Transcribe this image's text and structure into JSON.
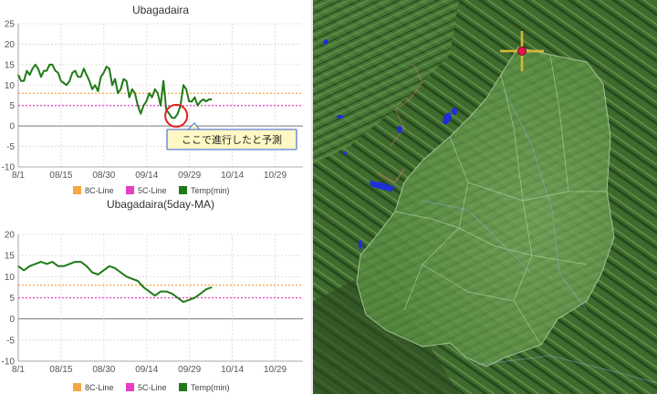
{
  "chart_data": [
    {
      "type": "line",
      "title": "Ubagadaira",
      "x_ticks": [
        "8/1",
        "08/15",
        "08/30",
        "09/14",
        "09/29",
        "10/14",
        "10/29"
      ],
      "y_ticks": [
        25,
        20,
        15,
        10,
        5,
        0,
        -5,
        -10
      ],
      "ylim": [
        -10,
        25
      ],
      "grid": true,
      "legend": [
        "8C-Line",
        "5C-Line",
        "Temp(min)"
      ],
      "legend_position": "bottom",
      "annotation": "ここで進行したと予測",
      "series": [
        {
          "name": "8C-Line",
          "color": "#f5a742",
          "style": "dotted",
          "x": [
            0,
            100
          ],
          "values": [
            8,
            8
          ]
        },
        {
          "name": "5C-Line",
          "color": "#e83ec4",
          "style": "dotted",
          "x": [
            0,
            100
          ],
          "values": [
            5,
            5
          ]
        },
        {
          "name": "Temp(min)",
          "color": "#1f7a17",
          "style": "solid",
          "x": [
            0,
            1,
            2,
            3,
            4,
            5,
            6,
            7,
            8,
            9,
            10,
            11,
            12,
            13,
            14,
            15,
            16,
            17,
            18,
            19,
            20,
            21,
            22,
            23,
            24,
            25,
            26,
            27,
            28,
            29,
            30,
            31,
            32,
            33,
            34,
            35,
            36,
            37,
            38,
            39,
            40,
            41,
            42,
            43,
            44,
            45,
            46,
            47,
            48,
            49,
            50,
            51,
            52,
            53,
            54,
            55,
            56,
            57,
            58,
            59,
            60,
            61,
            62,
            63,
            64,
            65,
            66,
            67,
            68
          ],
          "values": [
            12.5,
            11,
            11,
            13.5,
            12.5,
            14,
            15,
            14,
            12,
            13.5,
            13.5,
            15,
            15,
            13.5,
            13,
            11,
            10.5,
            10,
            11,
            13,
            13.5,
            12,
            12,
            14,
            12.5,
            11,
            9,
            10,
            8.5,
            12,
            13,
            14.5,
            14,
            10,
            11.5,
            8,
            9,
            11.5,
            11,
            7,
            9,
            8,
            5,
            3,
            5,
            6,
            8,
            7,
            9,
            8,
            5,
            11,
            4,
            3,
            2,
            2,
            3,
            5,
            10,
            9,
            6,
            6,
            7,
            5,
            6,
            6.5,
            6,
            6.5,
            6.5
          ]
        }
      ]
    },
    {
      "type": "line",
      "title": "Ubagadaira(5day-MA)",
      "x_ticks": [
        "8/1",
        "08/15",
        "08/30",
        "09/14",
        "09/29",
        "10/14",
        "10/29"
      ],
      "y_ticks": [
        20,
        15,
        10,
        5,
        0,
        -5,
        -10
      ],
      "ylim": [
        -10,
        20
      ],
      "grid": true,
      "legend": [
        "8C-Line",
        "5C-Line",
        "Temp(min)"
      ],
      "legend_position": "bottom",
      "series": [
        {
          "name": "8C-Line",
          "color": "#f5a742",
          "style": "dotted",
          "x": [
            0,
            100
          ],
          "values": [
            8,
            8
          ]
        },
        {
          "name": "5C-Line",
          "color": "#e83ec4",
          "style": "dotted",
          "x": [
            0,
            100
          ],
          "values": [
            5,
            5
          ]
        },
        {
          "name": "Temp(min)",
          "color": "#1f7a17",
          "style": "solid",
          "x": [
            0,
            2,
            4,
            6,
            8,
            10,
            12,
            14,
            16,
            18,
            20,
            22,
            24,
            26,
            28,
            30,
            32,
            34,
            36,
            38,
            40,
            42,
            44,
            46,
            48,
            50,
            52,
            54,
            56,
            58,
            60,
            62,
            64,
            66,
            68
          ],
          "values": [
            12.5,
            11.5,
            12.5,
            13,
            13.5,
            13,
            13.5,
            12.5,
            12.5,
            13,
            13.5,
            13.5,
            12.5,
            11,
            10.5,
            11.5,
            12.5,
            12,
            11,
            10,
            9.5,
            9,
            7.5,
            6.5,
            5.5,
            6.5,
            6.5,
            6,
            5,
            4,
            4.5,
            5,
            6,
            7,
            7.5
          ]
        }
      ]
    }
  ],
  "map": {
    "marker": "crosshair-marker",
    "colors": {
      "land": "#4f8a3a",
      "highlight": "#7fae5f",
      "water": "#1e2fd6",
      "relief": "#6b5a3a"
    }
  }
}
